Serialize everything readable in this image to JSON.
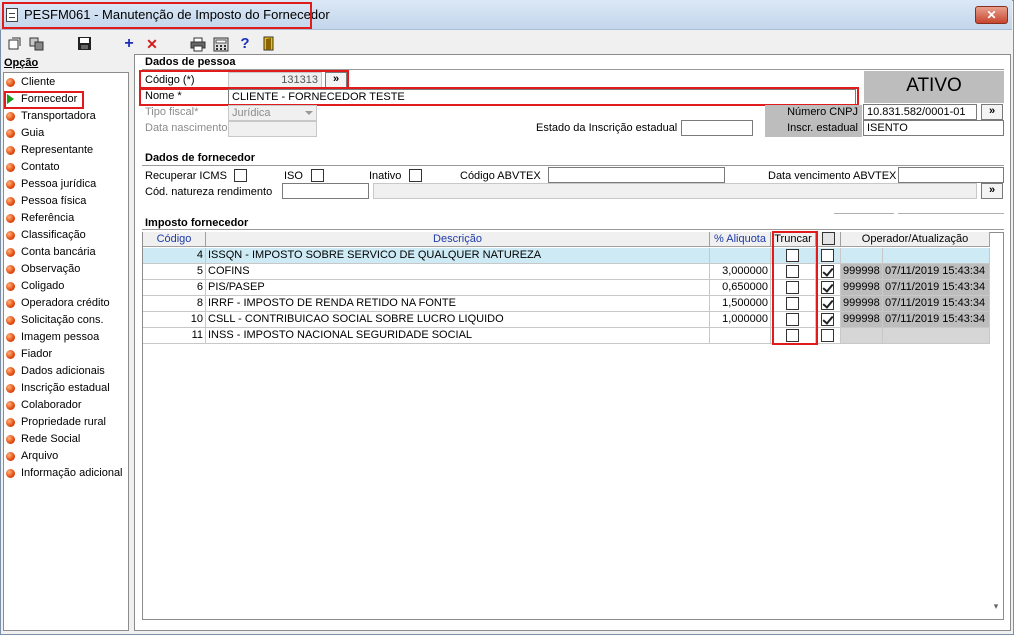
{
  "window": {
    "title": "PESFM061 - Manutenção de Imposto do Fornecedor",
    "close_glyph": "✕"
  },
  "toolbar": {
    "add": "+",
    "remove": "✕",
    "help": "?"
  },
  "sidebar": {
    "title": "Opção",
    "items": [
      "Cliente",
      "Fornecedor",
      "Transportadora",
      "Guia",
      "Representante",
      "Contato",
      "Pessoa jurídica",
      "Pessoa física",
      "Referência",
      "Classificação",
      "Conta bancária",
      "Observação",
      "Coligado",
      "Operadora crédito",
      "Solicitação cons.",
      "Imagem pessoa",
      "Fiador",
      "Dados adicionais",
      "Inscrição estadual",
      "Colaborador",
      "Propriedade rural",
      "Rede Social",
      "Arquivo",
      "Informação adicional"
    ],
    "selected_index": 1
  },
  "dados_pessoa": {
    "title": "Dados de pessoa",
    "codigo_label": "Código (*)",
    "codigo_value": "131313",
    "nome_label": "Nome *",
    "nome_value": "CLIENTE - FORNECEDOR TESTE",
    "tipo_fiscal_label": "Tipo fiscal*",
    "tipo_fiscal_value": "Jurídica",
    "data_nascimento_label": "Data nascimento",
    "estado_ie_label": "Estado da Inscrição estadual",
    "status": "ATIVO",
    "cnpj_label": "Número CNPJ",
    "cnpj_value": "10.831.582/0001-01",
    "ie_label": "Inscr. estadual",
    "ie_value": "ISENTO",
    "more_glyph": "»"
  },
  "dados_fornecedor": {
    "title": "Dados de fornecedor",
    "recuperar_icms": "Recuperar ICMS",
    "iso": "ISO",
    "inativo": "Inativo",
    "codigo_abvtex": "Código ABVTEX",
    "data_venc_abvtex": "Data vencimento ABVTEX",
    "cod_natureza": "Cód. natureza rendimento"
  },
  "imposto": {
    "title": "Imposto fornecedor",
    "headers": {
      "codigo": "Código",
      "descricao": "Descrição",
      "aliquota": "% Aliquota",
      "truncar": "Truncar",
      "operador": "Operador/Atualização"
    },
    "rows": [
      {
        "codigo": "4",
        "descricao": "ISSQN - IMPOSTO SOBRE SERVICO DE QUALQUER NATUREZA",
        "aliquota": "",
        "truncar": false,
        "ativo": false,
        "operador": "",
        "atualizacao": ""
      },
      {
        "codigo": "5",
        "descricao": "COFINS",
        "aliquota": "3,000000",
        "truncar": false,
        "ativo": true,
        "operador": "999998",
        "atualizacao": "07/11/2019 15:43:34"
      },
      {
        "codigo": "6",
        "descricao": "PIS/PASEP",
        "aliquota": "0,650000",
        "truncar": false,
        "ativo": true,
        "operador": "999998",
        "atualizacao": "07/11/2019 15:43:34"
      },
      {
        "codigo": "8",
        "descricao": "IRRF - IMPOSTO DE RENDA RETIDO NA FONTE",
        "aliquota": "1,500000",
        "truncar": false,
        "ativo": true,
        "operador": "999998",
        "atualizacao": "07/11/2019 15:43:34"
      },
      {
        "codigo": "10",
        "descricao": "CSLL - CONTRIBUICAO SOCIAL SOBRE LUCRO LIQUIDO",
        "aliquota": "1,000000",
        "truncar": false,
        "ativo": true,
        "operador": "999998",
        "atualizacao": "07/11/2019 15:43:34"
      },
      {
        "codigo": "11",
        "descricao": "INSS - IMPOSTO NACIONAL SEGURIDADE SOCIAL",
        "aliquota": "",
        "truncar": false,
        "ativo": false,
        "operador": "",
        "atualizacao": ""
      }
    ]
  }
}
